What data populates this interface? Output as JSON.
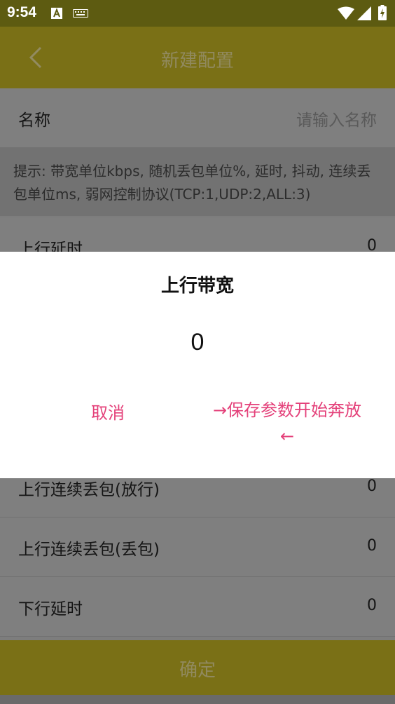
{
  "status_bar": {
    "time": "9:54",
    "icons": [
      "notification-a-icon",
      "keyboard-icon",
      "wifi-icon",
      "signal-icon",
      "battery-charging-icon"
    ]
  },
  "app_bar": {
    "title": "新建配置",
    "back_icon": "chevron-left-icon"
  },
  "form": {
    "name_label": "名称",
    "name_placeholder": "请输入名称",
    "hint": "提示: 带宽单位kbps, 随机丢包单位%, 延时, 抖动, 连续丢包单位ms, 弱网控制协议(TCP:1,UDP:2,ALL:3)",
    "rows": [
      {
        "label": "上行延时",
        "value": "0"
      },
      {
        "label": "上行连续丢包(放行)",
        "value": "0"
      },
      {
        "label": "上行连续丢包(丢包)",
        "value": "0"
      },
      {
        "label": "下行延时",
        "value": "0"
      }
    ],
    "confirm_label": "确定"
  },
  "dialog": {
    "title": "上行带宽",
    "value": "0",
    "cancel_label": "取消",
    "ok_label": "→保存参数开始奔放←"
  },
  "colors": {
    "app_bar": "#7a7016",
    "status_bar": "#5d5b11",
    "dialog_accent": "#e4417a",
    "scrim": "#7d7d7d"
  }
}
